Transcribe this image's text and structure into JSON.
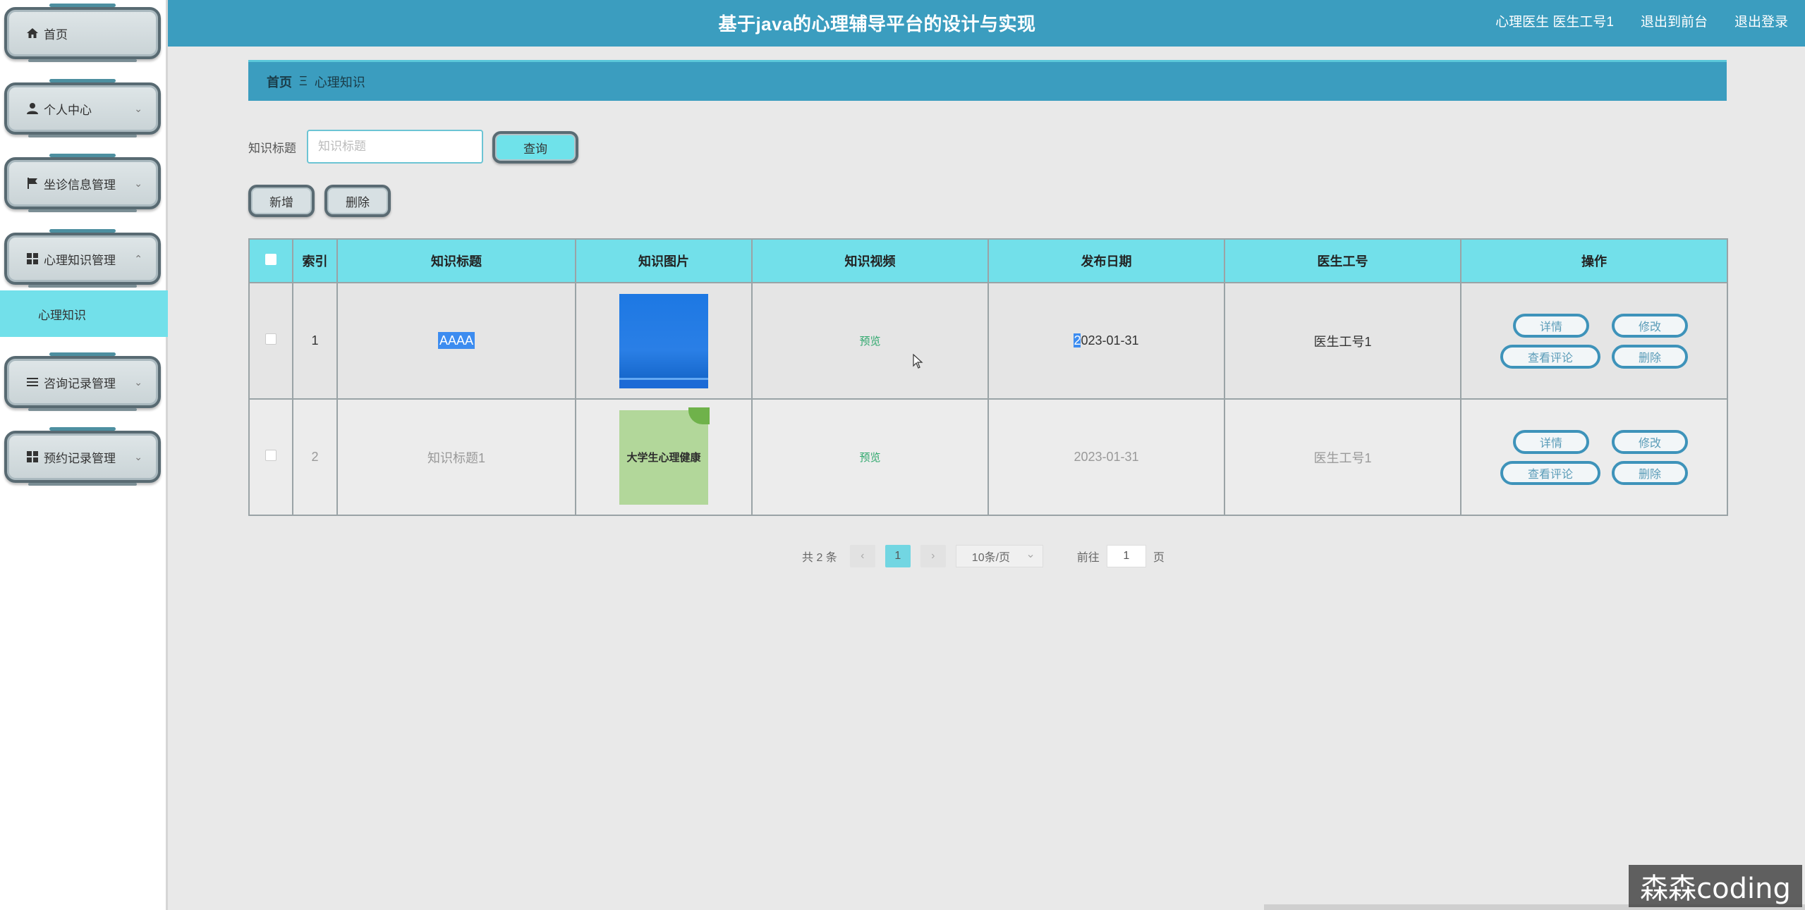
{
  "header": {
    "title": "基于java的心理辅导平台的设计与实现",
    "user": "心理医生 医生工号1",
    "to_front": "退出到前台",
    "logout": "退出登录"
  },
  "sidebar": {
    "items": [
      {
        "label": "首页",
        "icon": "home-icon"
      },
      {
        "label": "个人中心",
        "icon": "user-icon"
      },
      {
        "label": "坐诊信息管理",
        "icon": "flag-icon"
      },
      {
        "label": "心理知识管理",
        "icon": "grid-icon"
      },
      {
        "label": "咨询记录管理",
        "icon": "list-icon"
      },
      {
        "label": "预约记录管理",
        "icon": "grid-icon"
      }
    ],
    "active_sub": "心理知识"
  },
  "breadcrumb": {
    "home": "首页",
    "separator": "Ξ",
    "current": "心理知识"
  },
  "search": {
    "label": "知识标题",
    "placeholder": "知识标题",
    "value": "",
    "query_label": "查询"
  },
  "toolbar": {
    "add_label": "新增",
    "delete_label": "删除"
  },
  "table": {
    "headers": [
      "索引",
      "知识标题",
      "知识图片",
      "知识视频",
      "发布日期",
      "医生工号",
      "操作"
    ],
    "rows": [
      {
        "index": "1",
        "title": "AAAA",
        "video": "预览",
        "date_first": "2",
        "date_rest": "023-01-31",
        "doctor": "医生工号1"
      },
      {
        "index": "2",
        "title": "知识标题1",
        "image_text": "大学生心理健康",
        "video": "预览",
        "date": "2023-01-31",
        "doctor": "医生工号1"
      }
    ],
    "actions": {
      "detail": "详情",
      "edit": "修改",
      "review": "查看评论",
      "delete": "删除"
    }
  },
  "pagination": {
    "total": "共 2 条",
    "prev": "‹",
    "page": "1",
    "next": "›",
    "page_size": "10条/页",
    "goto_label": "前往",
    "goto_value": "1",
    "page_suffix": "页"
  },
  "watermark": "森森coding",
  "colors": {
    "header": "#3b9dbf",
    "accent": "#72e0ea",
    "preview": "#2fa86d"
  }
}
